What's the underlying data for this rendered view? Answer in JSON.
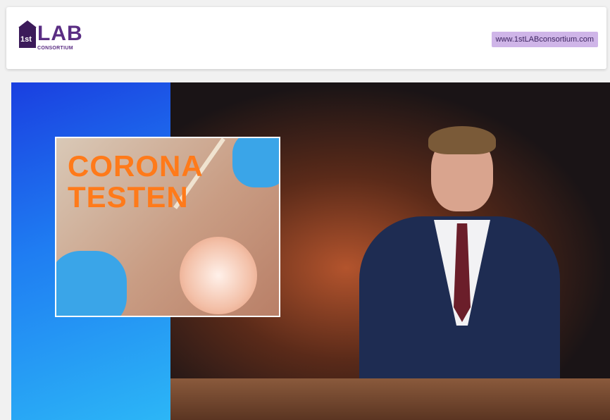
{
  "header": {
    "logo": {
      "number": "1st",
      "word": "LAB",
      "subtitle": "CONSORTIUM"
    },
    "url": "www.1stLABconsortium.com"
  },
  "video": {
    "thumbnail": {
      "line1": "CORONA",
      "line2": "TESTEN"
    }
  },
  "colors": {
    "brand_purple": "#5a2d83",
    "url_badge": "#cfb5e8",
    "blue_panel": "#1f7df2",
    "title_orange": "#ff7a1a"
  }
}
